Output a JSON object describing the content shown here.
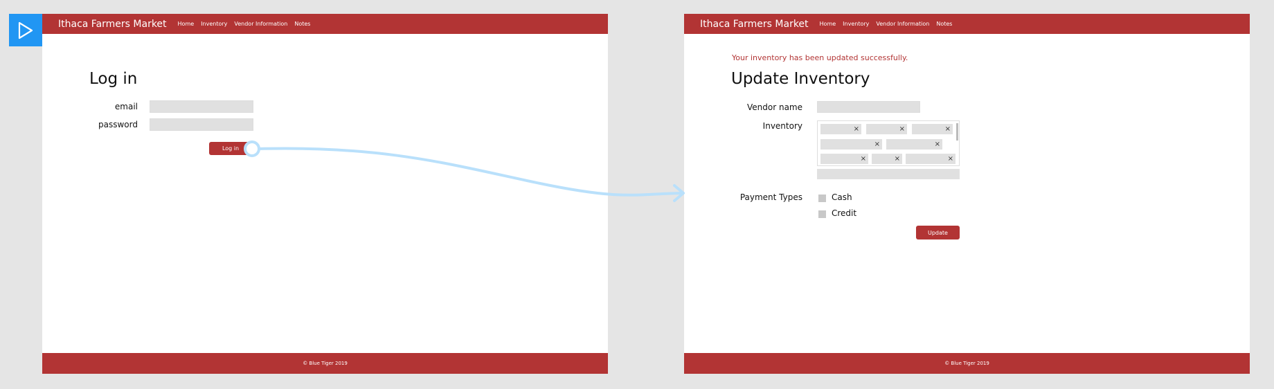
{
  "nav": {
    "brand": "Ithaca Farmers Market",
    "links": [
      "Home",
      "Inventory",
      "Vendor Information",
      "Notes"
    ]
  },
  "footer": {
    "text": "© Blue Tiger 2019"
  },
  "login": {
    "title": "Log in",
    "email_label": "email",
    "password_label": "password",
    "button_label": "Log in"
  },
  "update": {
    "success_message": "Your inventory has been updated successfully.",
    "title": "Update Inventory",
    "vendor_label": "Vendor name",
    "inventory_label": "Inventory",
    "chip_close": "×",
    "payment_label": "Payment Types",
    "payment_options": [
      "Cash",
      "Credit"
    ],
    "button_label": "Update"
  },
  "colors": {
    "brand": "#b23434",
    "accent": "#2196f3",
    "flow_arrow": "#b9e0fb"
  },
  "icons": {
    "play": "play-icon",
    "chip_remove": "close-icon",
    "flow": "flow-arrow"
  }
}
